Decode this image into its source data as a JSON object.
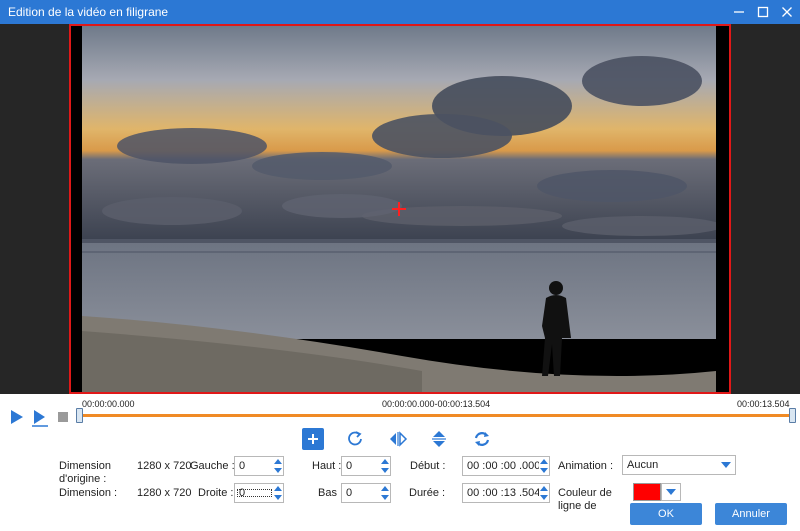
{
  "window": {
    "title": "Edition de la vidéo en filigrane"
  },
  "timeline": {
    "start": "00:00:00.000",
    "range": "00:00:00.000-00:00:13.504",
    "end": "00:00:13.504"
  },
  "form": {
    "orig_dim_label": "Dimension d'origine :",
    "orig_dim_value": "1280 x 720",
    "dim_label": "Dimension :",
    "dim_value": "1280 x 720",
    "left_label": "Gauche :",
    "left_value": "0",
    "right_label": "Droite :",
    "right_value": "0",
    "top_label": "Haut :",
    "top_value": "0",
    "bottom_label": "Bas :",
    "bottom_value": "0",
    "start_label": "Début :",
    "start_value": "00 :00 :00 .000",
    "duration_label": "Durée :",
    "duration_value": "00 :00 :13 .504",
    "animation_label": "Animation :",
    "animation_value": "Aucun",
    "line_color_label": "Couleur de ligne de",
    "line_color": "#ff0000"
  },
  "buttons": {
    "ok": "OK",
    "cancel": "Annuler"
  },
  "colors": {
    "accent": "#2c78d4",
    "timeline": "#f08a25",
    "frame": "#e01818"
  }
}
